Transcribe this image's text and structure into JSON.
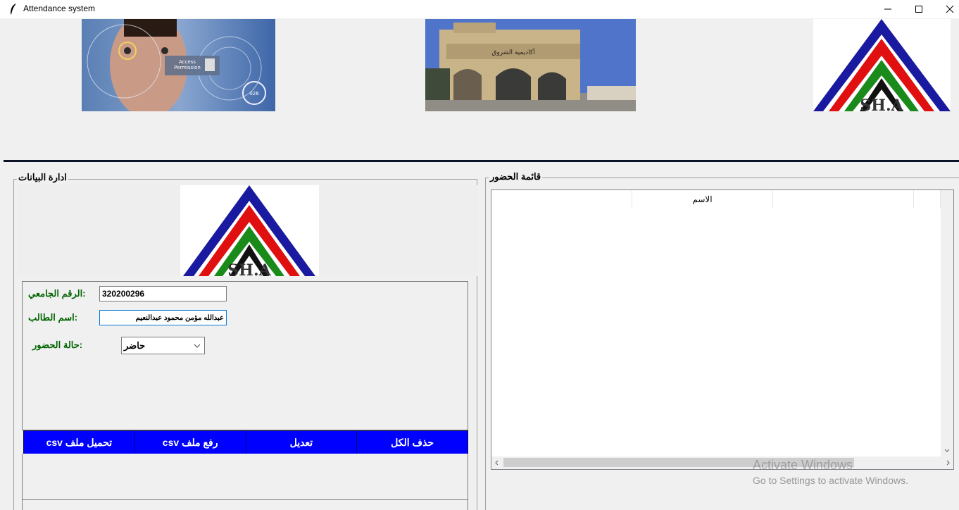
{
  "window": {
    "title": "Attendance system",
    "controls": [
      "minimize-icon",
      "maximize-icon",
      "close-icon"
    ]
  },
  "header": {
    "logo_text": "SH.A",
    "badge_lines": [
      "Access",
      "Permission"
    ],
    "building_sign": "أكاديمية الشروق",
    "badge_number": "026"
  },
  "data_panel": {
    "title": "ادارة البيانات",
    "logo_text": "SH.A",
    "fields": {
      "university_id_label": ":الرقم الجامعي",
      "university_id_value": "320200296",
      "student_name_label": ":اسم الطالب",
      "student_name_value": "عبدالله مؤمن محمود عبدالنعيم",
      "attendance_label": ":حالة الحضور",
      "attendance_value": "حاضر"
    },
    "buttons": {
      "download_csv": "تحميل ملف csv",
      "upload_csv": "رفع ملف csv",
      "edit": "تعديل",
      "delete_all": "حذف الكل"
    }
  },
  "list_panel": {
    "title": "قائمة الحضور",
    "columns": [
      "",
      "الاسم",
      "",
      ""
    ]
  },
  "watermark": {
    "line1": "Activate Windows",
    "line2": "Go to Settings to activate Windows."
  },
  "colors": {
    "button_bg": "#0000ff",
    "label_green": "#006400",
    "logo_blue": "#1a1aa0",
    "logo_red": "#e01010",
    "logo_green": "#1a8a1a"
  }
}
